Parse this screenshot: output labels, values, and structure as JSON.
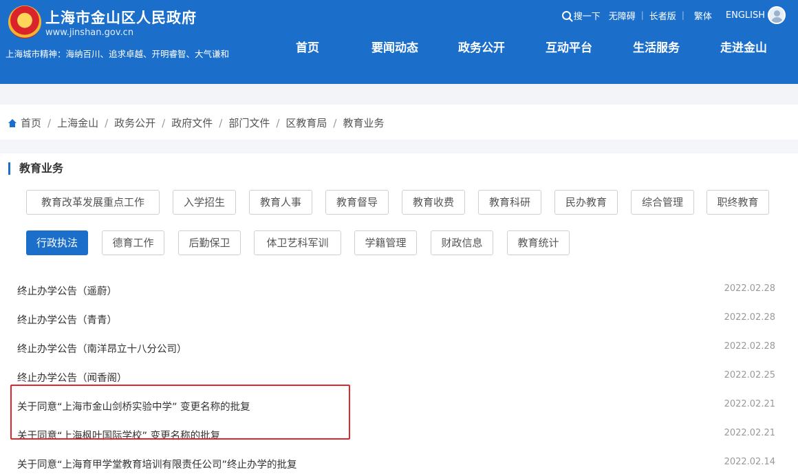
{
  "header": {
    "title": "上海市金山区人民政府",
    "url": "www.jinshan.gov.cn",
    "spirit": "上海城市精神：海纳百川、追求卓越、开明睿智、大气谦和",
    "brand_color": "#1b6fcb"
  },
  "topbar": {
    "search": "搜一下",
    "accessibility": "无障碍",
    "elder": "长者版",
    "traditional": "繁体",
    "english": "ENGLISH"
  },
  "nav": [
    "首页",
    "要闻动态",
    "政务公开",
    "互动平台",
    "生活服务",
    "走进金山"
  ],
  "breadcrumb": [
    "首页",
    "上海金山",
    "政务公开",
    "政府文件",
    "部门文件",
    "区教育局",
    "教育业务"
  ],
  "section_title": "教育业务",
  "tags_row1": [
    "教育改革发展重点工作",
    "入学招生",
    "教育人事",
    "教育督导",
    "教育收费",
    "教育科研",
    "民办教育",
    "综合管理",
    "职终教育"
  ],
  "tags_row2": [
    "行政执法",
    "德育工作",
    "后勤保卫",
    "体卫艺科军训",
    "学籍管理",
    "财政信息",
    "教育统计"
  ],
  "active_tag": "行政执法",
  "list": [
    {
      "title": "终止办学公告（遥蔚）",
      "date": "2022.02.28"
    },
    {
      "title": "终止办学公告（青青）",
      "date": "2022.02.28"
    },
    {
      "title": "终止办学公告（南洋昂立十八分公司）",
      "date": "2022.02.28"
    },
    {
      "title": "终止办学公告（闻香阁）",
      "date": "2022.02.25"
    },
    {
      "title": "关于同意“上海市金山剑桥实验中学” 变更名称的批复",
      "date": "2022.02.21"
    },
    {
      "title": "关于同意“上海枫叶国际学校” 变更名称的批复",
      "date": "2022.02.21"
    },
    {
      "title": "关于同意“上海育甲学堂教育培训有限责任公司”终止办学的批复",
      "date": "2022.02.14"
    }
  ],
  "highlight_color": "#e0262d"
}
